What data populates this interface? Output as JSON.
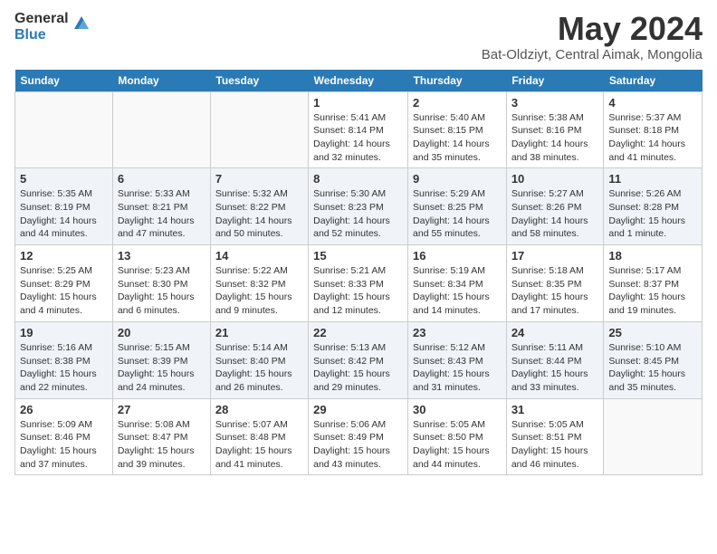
{
  "logo": {
    "general": "General",
    "blue": "Blue"
  },
  "title": "May 2024",
  "location": "Bat-Oldziyt, Central Aimak, Mongolia",
  "days_of_week": [
    "Sunday",
    "Monday",
    "Tuesday",
    "Wednesday",
    "Thursday",
    "Friday",
    "Saturday"
  ],
  "weeks": [
    [
      {
        "day": "",
        "sunrise": "",
        "sunset": "",
        "daylight": ""
      },
      {
        "day": "",
        "sunrise": "",
        "sunset": "",
        "daylight": ""
      },
      {
        "day": "",
        "sunrise": "",
        "sunset": "",
        "daylight": ""
      },
      {
        "day": "1",
        "sunrise": "Sunrise: 5:41 AM",
        "sunset": "Sunset: 8:14 PM",
        "daylight": "Daylight: 14 hours and 32 minutes."
      },
      {
        "day": "2",
        "sunrise": "Sunrise: 5:40 AM",
        "sunset": "Sunset: 8:15 PM",
        "daylight": "Daylight: 14 hours and 35 minutes."
      },
      {
        "day": "3",
        "sunrise": "Sunrise: 5:38 AM",
        "sunset": "Sunset: 8:16 PM",
        "daylight": "Daylight: 14 hours and 38 minutes."
      },
      {
        "day": "4",
        "sunrise": "Sunrise: 5:37 AM",
        "sunset": "Sunset: 8:18 PM",
        "daylight": "Daylight: 14 hours and 41 minutes."
      }
    ],
    [
      {
        "day": "5",
        "sunrise": "Sunrise: 5:35 AM",
        "sunset": "Sunset: 8:19 PM",
        "daylight": "Daylight: 14 hours and 44 minutes."
      },
      {
        "day": "6",
        "sunrise": "Sunrise: 5:33 AM",
        "sunset": "Sunset: 8:21 PM",
        "daylight": "Daylight: 14 hours and 47 minutes."
      },
      {
        "day": "7",
        "sunrise": "Sunrise: 5:32 AM",
        "sunset": "Sunset: 8:22 PM",
        "daylight": "Daylight: 14 hours and 50 minutes."
      },
      {
        "day": "8",
        "sunrise": "Sunrise: 5:30 AM",
        "sunset": "Sunset: 8:23 PM",
        "daylight": "Daylight: 14 hours and 52 minutes."
      },
      {
        "day": "9",
        "sunrise": "Sunrise: 5:29 AM",
        "sunset": "Sunset: 8:25 PM",
        "daylight": "Daylight: 14 hours and 55 minutes."
      },
      {
        "day": "10",
        "sunrise": "Sunrise: 5:27 AM",
        "sunset": "Sunset: 8:26 PM",
        "daylight": "Daylight: 14 hours and 58 minutes."
      },
      {
        "day": "11",
        "sunrise": "Sunrise: 5:26 AM",
        "sunset": "Sunset: 8:28 PM",
        "daylight": "Daylight: 15 hours and 1 minute."
      }
    ],
    [
      {
        "day": "12",
        "sunrise": "Sunrise: 5:25 AM",
        "sunset": "Sunset: 8:29 PM",
        "daylight": "Daylight: 15 hours and 4 minutes."
      },
      {
        "day": "13",
        "sunrise": "Sunrise: 5:23 AM",
        "sunset": "Sunset: 8:30 PM",
        "daylight": "Daylight: 15 hours and 6 minutes."
      },
      {
        "day": "14",
        "sunrise": "Sunrise: 5:22 AM",
        "sunset": "Sunset: 8:32 PM",
        "daylight": "Daylight: 15 hours and 9 minutes."
      },
      {
        "day": "15",
        "sunrise": "Sunrise: 5:21 AM",
        "sunset": "Sunset: 8:33 PM",
        "daylight": "Daylight: 15 hours and 12 minutes."
      },
      {
        "day": "16",
        "sunrise": "Sunrise: 5:19 AM",
        "sunset": "Sunset: 8:34 PM",
        "daylight": "Daylight: 15 hours and 14 minutes."
      },
      {
        "day": "17",
        "sunrise": "Sunrise: 5:18 AM",
        "sunset": "Sunset: 8:35 PM",
        "daylight": "Daylight: 15 hours and 17 minutes."
      },
      {
        "day": "18",
        "sunrise": "Sunrise: 5:17 AM",
        "sunset": "Sunset: 8:37 PM",
        "daylight": "Daylight: 15 hours and 19 minutes."
      }
    ],
    [
      {
        "day": "19",
        "sunrise": "Sunrise: 5:16 AM",
        "sunset": "Sunset: 8:38 PM",
        "daylight": "Daylight: 15 hours and 22 minutes."
      },
      {
        "day": "20",
        "sunrise": "Sunrise: 5:15 AM",
        "sunset": "Sunset: 8:39 PM",
        "daylight": "Daylight: 15 hours and 24 minutes."
      },
      {
        "day": "21",
        "sunrise": "Sunrise: 5:14 AM",
        "sunset": "Sunset: 8:40 PM",
        "daylight": "Daylight: 15 hours and 26 minutes."
      },
      {
        "day": "22",
        "sunrise": "Sunrise: 5:13 AM",
        "sunset": "Sunset: 8:42 PM",
        "daylight": "Daylight: 15 hours and 29 minutes."
      },
      {
        "day": "23",
        "sunrise": "Sunrise: 5:12 AM",
        "sunset": "Sunset: 8:43 PM",
        "daylight": "Daylight: 15 hours and 31 minutes."
      },
      {
        "day": "24",
        "sunrise": "Sunrise: 5:11 AM",
        "sunset": "Sunset: 8:44 PM",
        "daylight": "Daylight: 15 hours and 33 minutes."
      },
      {
        "day": "25",
        "sunrise": "Sunrise: 5:10 AM",
        "sunset": "Sunset: 8:45 PM",
        "daylight": "Daylight: 15 hours and 35 minutes."
      }
    ],
    [
      {
        "day": "26",
        "sunrise": "Sunrise: 5:09 AM",
        "sunset": "Sunset: 8:46 PM",
        "daylight": "Daylight: 15 hours and 37 minutes."
      },
      {
        "day": "27",
        "sunrise": "Sunrise: 5:08 AM",
        "sunset": "Sunset: 8:47 PM",
        "daylight": "Daylight: 15 hours and 39 minutes."
      },
      {
        "day": "28",
        "sunrise": "Sunrise: 5:07 AM",
        "sunset": "Sunset: 8:48 PM",
        "daylight": "Daylight: 15 hours and 41 minutes."
      },
      {
        "day": "29",
        "sunrise": "Sunrise: 5:06 AM",
        "sunset": "Sunset: 8:49 PM",
        "daylight": "Daylight: 15 hours and 43 minutes."
      },
      {
        "day": "30",
        "sunrise": "Sunrise: 5:05 AM",
        "sunset": "Sunset: 8:50 PM",
        "daylight": "Daylight: 15 hours and 44 minutes."
      },
      {
        "day": "31",
        "sunrise": "Sunrise: 5:05 AM",
        "sunset": "Sunset: 8:51 PM",
        "daylight": "Daylight: 15 hours and 46 minutes."
      },
      {
        "day": "",
        "sunrise": "",
        "sunset": "",
        "daylight": ""
      }
    ]
  ]
}
